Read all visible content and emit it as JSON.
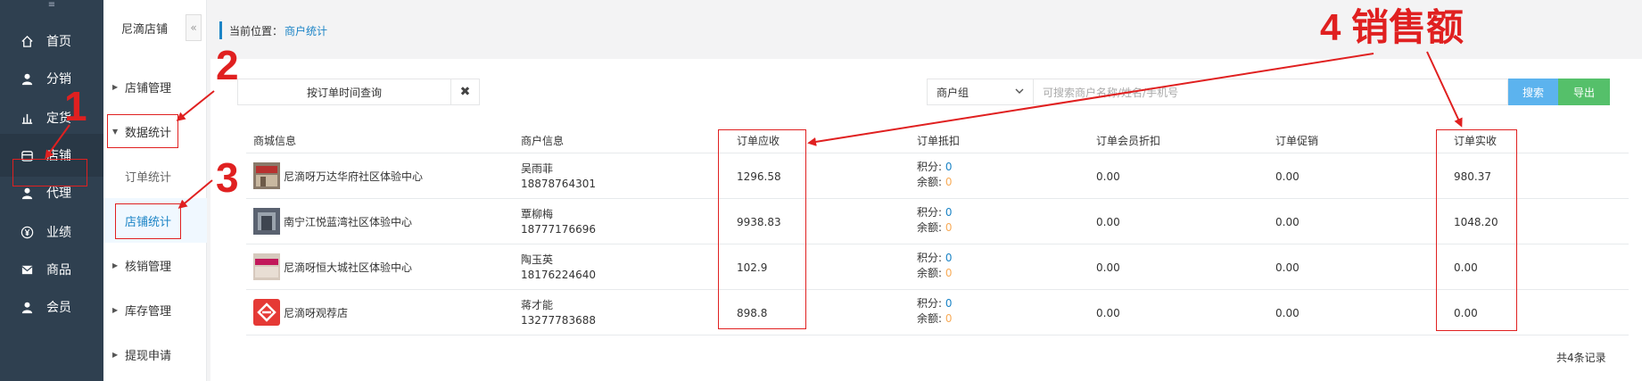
{
  "nav": {
    "top_glyph": "≡",
    "items": [
      {
        "label": "首页",
        "icon": "home-icon"
      },
      {
        "label": "分销",
        "icon": "user-icon"
      },
      {
        "label": "定货",
        "icon": "bar-chart-icon"
      },
      {
        "label": "店铺",
        "icon": "store-icon"
      },
      {
        "label": "代理",
        "icon": "user-icon"
      },
      {
        "label": "业绩",
        "icon": "yen-icon"
      },
      {
        "label": "商品",
        "icon": "mail-icon"
      },
      {
        "label": "会员",
        "icon": "user-icon"
      }
    ]
  },
  "subnav": {
    "title": "尼滴店铺",
    "collapse": "«",
    "items": [
      {
        "label": "店铺管理"
      },
      {
        "label": "数据统计"
      },
      {
        "label": "订单统计"
      },
      {
        "label": "店铺统计"
      },
      {
        "label": "核销管理"
      },
      {
        "label": "库存管理"
      },
      {
        "label": "提现申请"
      }
    ]
  },
  "breadcrumb": {
    "label": "当前位置：",
    "link": "商户统计"
  },
  "toolbar": {
    "date_query": "按订单时间查询",
    "clear": "✖",
    "group_select": "商户组",
    "search_placeholder": "可搜索商户名称/姓名/手机号",
    "search_button": "搜索",
    "export_button": "导出"
  },
  "table": {
    "headers": [
      "商城信息",
      "商户信息",
      "订单应收",
      "订单抵扣",
      "订单会员折扣",
      "订单促销",
      "订单实收"
    ],
    "deduct_points_label": "积分:",
    "deduct_balance_label": "余额:",
    "rows": [
      {
        "shop": "尼滴呀万达华府社区体验中心",
        "merchant": "吴雨菲",
        "phone": "18878764301",
        "receivable": "1296.58",
        "points": "0",
        "balance": "0",
        "member_discount": "0.00",
        "promotion": "0.00",
        "received": "980.37"
      },
      {
        "shop": "南宁江悦蓝湾社区体验中心",
        "merchant": "覃柳梅",
        "phone": "18777176696",
        "receivable": "9938.83",
        "points": "0",
        "balance": "0",
        "member_discount": "0.00",
        "promotion": "0.00",
        "received": "1048.20"
      },
      {
        "shop": "尼滴呀恒大城社区体验中心",
        "merchant": "陶玉英",
        "phone": "18176224640",
        "receivable": "102.9",
        "points": "0",
        "balance": "0",
        "member_discount": "0.00",
        "promotion": "0.00",
        "received": "0.00"
      },
      {
        "shop": "尼滴呀观荐店",
        "merchant": "蒋才能",
        "phone": "13277783688",
        "receivable": "898.8",
        "points": "0",
        "balance": "0",
        "member_discount": "0.00",
        "promotion": "0.00",
        "received": "0.00"
      }
    ],
    "total_records": "共4条记录"
  },
  "annotations": {
    "num1": "1",
    "num2": "2",
    "num3": "3",
    "num4_label": "4 销售额",
    "color": "#e02020"
  }
}
